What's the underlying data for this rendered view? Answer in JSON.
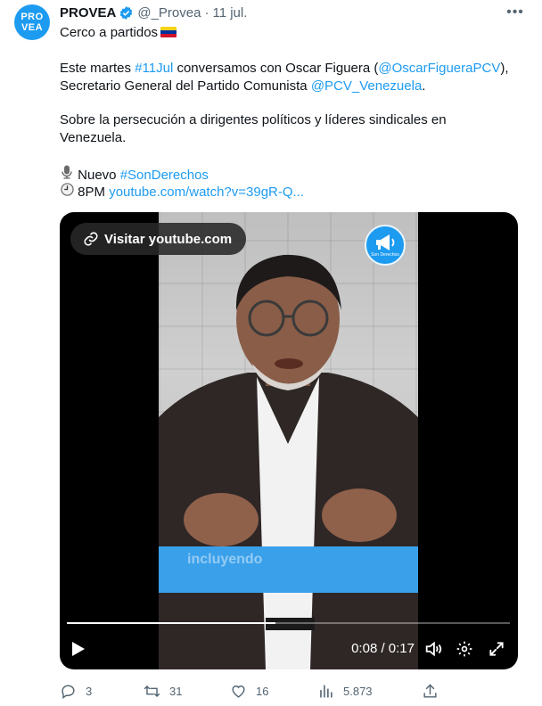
{
  "tweet": {
    "avatar_lines": [
      "PRO",
      "VEA"
    ],
    "author": "PROVEA",
    "handle": "@_Provea",
    "separator": "·",
    "time": "11 jul.",
    "line1": "Cerco a partidos",
    "p2_a": "Este martes ",
    "p2_hashtag": "#11Jul",
    "p2_b": " conversamos con Oscar Figuera (",
    "p2_mention1": "@OscarFigueraPCV",
    "p2_c": "),",
    "p2_d": "Secretario General del Partido Comunista ",
    "p2_mention2": "@PCV_Venezuela",
    "p2_e": ".",
    "p3_a": "Sobre la persecución a dirigentes políticos y líderes sindicales en",
    "p3_b": "Venezuela.",
    "l4_text": " Nuevo ",
    "l4_hashtag": "#SonDerechos",
    "l5_text": " 8PM ",
    "l5_link": "youtube.com/watch?v=39gR-Q..."
  },
  "media": {
    "visit_label": "Visitar youtube.com",
    "logo_text": "Son Derechos",
    "caption": "incluyendo",
    "timecode": "0:08 / 0:17",
    "progress": 0.47
  },
  "actions": {
    "replies": "3",
    "retweets": "31",
    "likes": "16",
    "views": "5.873"
  },
  "colors": {
    "accent": "#1d9bf0",
    "muted": "#536471",
    "flag": [
      "#f7d117",
      "#0033a0",
      "#cf142b"
    ]
  }
}
